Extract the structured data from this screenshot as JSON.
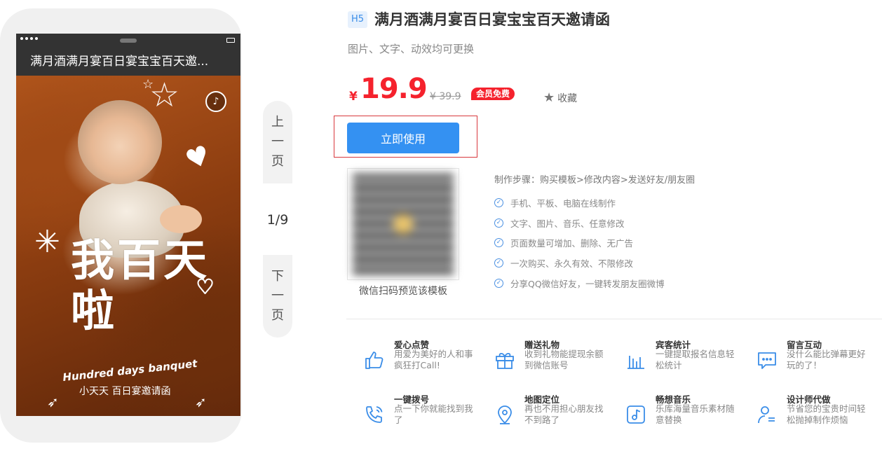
{
  "preview": {
    "title": "满月酒满月宴百日宴宝宝百天邀...",
    "big_title": "我百天啦",
    "english_line": "Hundred days banquet",
    "chinese_line": "小天天 百日宴邀请函"
  },
  "pager": {
    "prev_label": [
      "上",
      "一",
      "页"
    ],
    "next_label": [
      "下",
      "一",
      "页"
    ],
    "counter": "1/9"
  },
  "product": {
    "badge": "H5",
    "title": "满月酒满月宴百日宴宝宝百天邀请函",
    "subtitle": "图片、文字、动效均可更换",
    "price_symbol": "¥",
    "price": "19.9",
    "original_price": "¥ 39.9",
    "vip_badge": "会员免费",
    "favorite_label": "收藏",
    "cta_label": "立即使用",
    "qr_caption": "微信扫码预览该模板",
    "steps": "制作步骤：购买模板>修改内容>发送好友/朋友圈",
    "feature_points": [
      "手机、平板、电脑在线制作",
      "文字、图片、音乐、任意修改",
      "页面数量可增加、删除、无广告",
      "一次购买、永久有效、不限修改",
      "分享QQ微信好友，一键转发朋友圈微博"
    ]
  },
  "features": [
    {
      "icon": "thumb-up-icon",
      "title": "爱心点赞",
      "desc": "用爱为美好的人和事疯狂打Call!"
    },
    {
      "icon": "gift-icon",
      "title": "赠送礼物",
      "desc": "收到礼物能提现余额到微信账号"
    },
    {
      "icon": "bar-chart-icon",
      "title": "宾客统计",
      "desc": "一键提取报名信息轻松统计"
    },
    {
      "icon": "message-icon",
      "title": "留言互动",
      "desc": "没什么能比弹幕更好玩的了！"
    },
    {
      "icon": "phone-call-icon",
      "title": "一键拨号",
      "desc": "点一下你就能找到我了"
    },
    {
      "icon": "map-pin-icon",
      "title": "地图定位",
      "desc": "再也不用担心朋友找不到路了"
    },
    {
      "icon": "music-icon",
      "title": "畅想音乐",
      "desc": "乐库海量音乐素材随意替换"
    },
    {
      "icon": "designer-icon",
      "title": "设计师代做",
      "desc": "节省您的宝贵时间轻松抛掉制作烦恼"
    }
  ],
  "colors": {
    "accent": "#3491f2",
    "price": "#f5222d",
    "icon": "#3a8de8"
  }
}
